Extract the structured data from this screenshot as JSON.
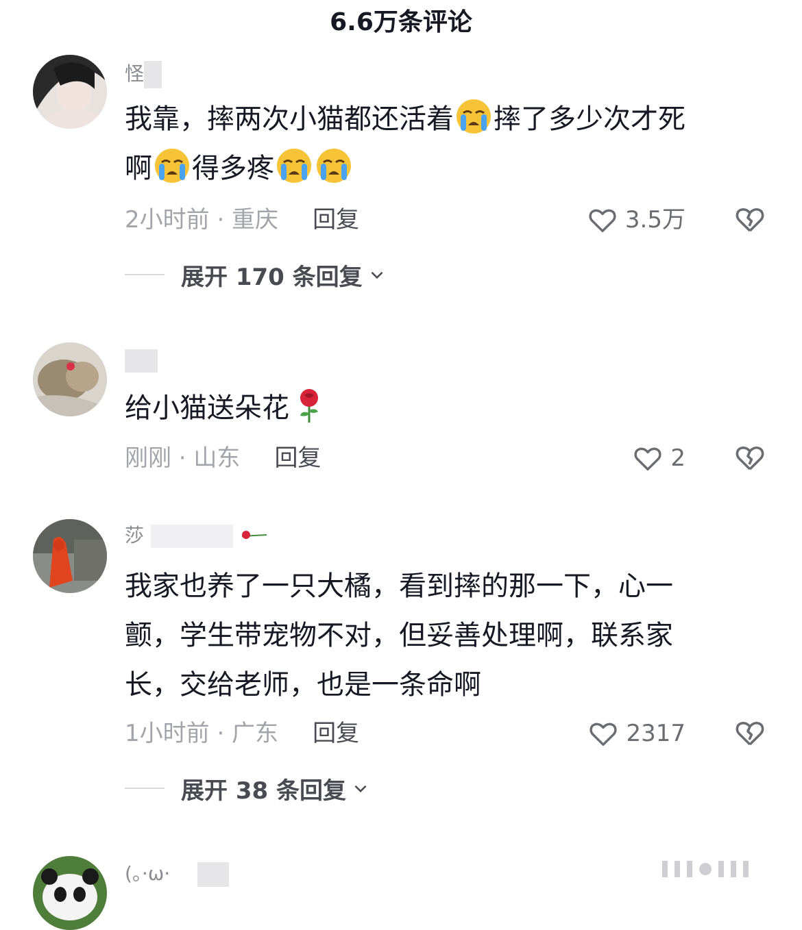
{
  "header": {
    "title": "6.6万条评论"
  },
  "comments": [
    {
      "username": "怪",
      "text_line1": "我靠，摔两次小猫都还活着",
      "text_line1b": "摔了多少次才死",
      "text_line2a": "啊",
      "text_line2b": "得多疼",
      "meta": "2小时前 · 重庆",
      "reply": "回复",
      "likes": "3.5万",
      "expand": "展开 170 条回复"
    },
    {
      "username": "",
      "text": "给小猫送朵花",
      "meta": "刚刚 · 山东",
      "reply": "回复",
      "likes": "2"
    },
    {
      "username": "莎",
      "text_line1": "我家也养了一只大橘，看到摔的那一下，心一",
      "text_line2": "颤，学生带宠物不对，但妥善处理啊，联系家",
      "text_line3": "长，交给老师，也是一条命啊",
      "meta": "1小时前 · 广东",
      "reply": "回复",
      "likes": "2317",
      "expand": "展开 38 条回复"
    },
    {
      "username": "(。·ω·"
    }
  ],
  "icons": {
    "like": "heart-outline-icon",
    "dislike": "broken-heart-icon",
    "crying": "loudly-crying-face-emoji",
    "rose": "rose-emoji",
    "chevron": "chevron-down-icon"
  },
  "colors": {
    "primary_text": "#161823",
    "secondary_text": "#a3a4aa",
    "accent_emoji": "#f7c437"
  }
}
